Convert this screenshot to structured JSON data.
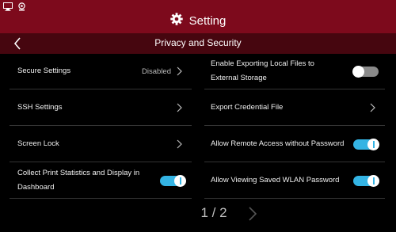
{
  "header": {
    "title": "Setting"
  },
  "subheader": {
    "title": "Privacy and Security"
  },
  "settings": {
    "left": [
      {
        "label": "Secure Settings",
        "value": "Disabled"
      },
      {
        "label": "SSH Settings"
      },
      {
        "label": "Screen Lock"
      },
      {
        "label": "Collect Print Statistics and Display in Dashboard",
        "toggle": "on"
      }
    ],
    "right": [
      {
        "label": "Enable Exporting Local Files to External Storage",
        "toggle": "off"
      },
      {
        "label": "Export Credential File"
      },
      {
        "label": "Allow Remote Access without Password",
        "toggle": "on"
      },
      {
        "label": "Allow Viewing Saved WLAN Password",
        "toggle": "on"
      }
    ]
  },
  "pager": {
    "text": "1 / 2"
  },
  "colors": {
    "header": "#7d0a1c",
    "subheader": "#46060f",
    "toggle_on": "#34b4e4",
    "toggle_off": "#8a8a8a"
  },
  "icons": [
    "monitor-icon",
    "webcam-icon",
    "gear-icon",
    "back-arrow-icon",
    "chevron-right-icon",
    "next-page-icon"
  ]
}
